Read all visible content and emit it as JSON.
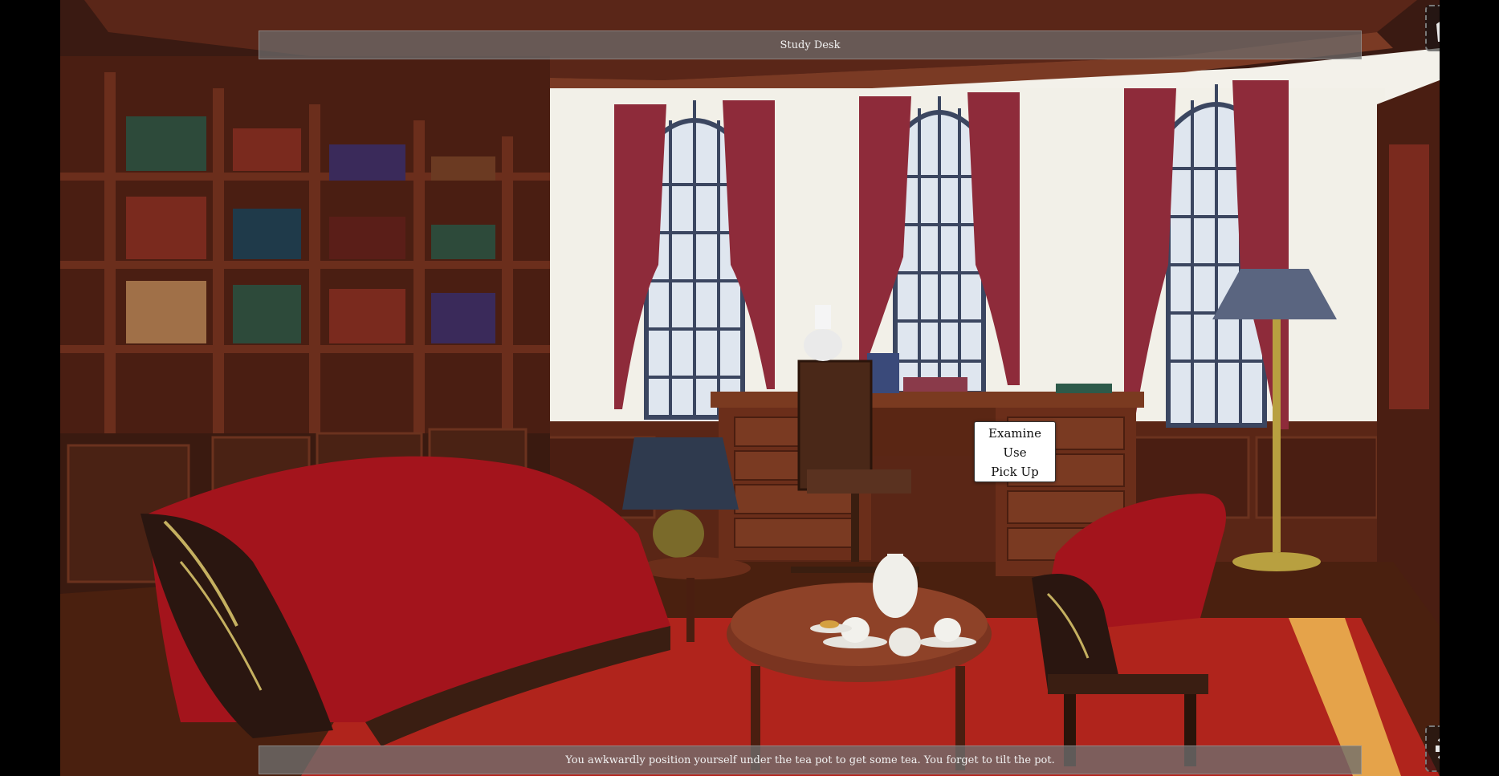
{
  "location": {
    "title": "Study Desk"
  },
  "message": {
    "text": "You awkwardly position yourself under the tea pot to get some tea. You forget to tilt the pot."
  },
  "context_menu": {
    "items": [
      {
        "label": "Examine"
      },
      {
        "label": "Use"
      },
      {
        "label": "Pick Up"
      }
    ]
  },
  "hud": {
    "inventory_icon": "satchel-icon",
    "settings_icon": "gear-icon"
  },
  "colors": {
    "wood_dark": "#3a1a12",
    "wood_mid": "#6b2e1c",
    "wood_light": "#8a4a2a",
    "curtain": "#8e2b3a",
    "sofa_red": "#a3141c",
    "rug_red": "#b0241c",
    "wall": "#f3f1ea",
    "window_frame": "#3b4660"
  }
}
